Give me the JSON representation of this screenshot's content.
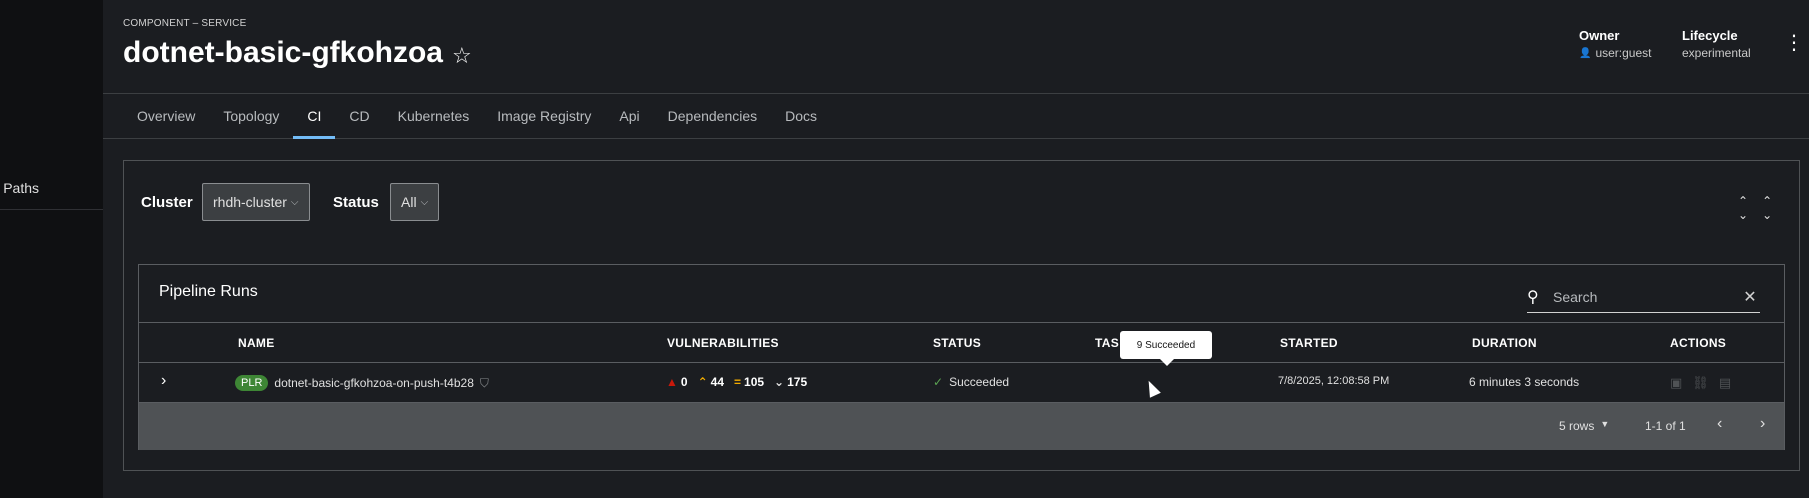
{
  "sidebar": {
    "item_label": "g Paths"
  },
  "header": {
    "kind": "COMPONENT – SERVICE",
    "title": "dotnet-basic-gfkohzoa",
    "owner_label": "Owner",
    "owner_value": "user:guest",
    "lifecycle_label": "Lifecycle",
    "lifecycle_value": "experimental"
  },
  "tabs": [
    {
      "label": "Overview"
    },
    {
      "label": "Topology"
    },
    {
      "label": "CI"
    },
    {
      "label": "CD"
    },
    {
      "label": "Kubernetes"
    },
    {
      "label": "Image Registry"
    },
    {
      "label": "Api"
    },
    {
      "label": "Dependencies"
    },
    {
      "label": "Docs"
    }
  ],
  "active_tab": "CI",
  "filters": {
    "cluster_label": "Cluster",
    "cluster_value": "rhdh-cluster",
    "status_label": "Status",
    "status_value": "All"
  },
  "runs": {
    "title": "Pipeline Runs",
    "search_placeholder": "Search",
    "columns": {
      "name": "NAME",
      "vulnerabilities": "VULNERABILITIES",
      "status": "STATUS",
      "task_status": "TAS",
      "started": "STARTED",
      "duration": "DURATION",
      "actions": "ACTIONS"
    },
    "rows": [
      {
        "badge": "PLR",
        "name": "dotnet-basic-gfkohzoa-on-push-t4b28",
        "critical": "0",
        "high": "44",
        "medium": "105",
        "low": "175",
        "status": "Succeeded",
        "started": "7/8/2025, 12:08:58 PM",
        "duration": "6 minutes 3 seconds"
      }
    ],
    "pagination": {
      "per_page": "5 rows",
      "range": "1-1 of 1"
    },
    "tooltip": "9 Succeeded"
  },
  "colors": {
    "accent": "#73bcf7",
    "success": "#3e8635",
    "critical": "#c9190b",
    "high": "#f0ab00"
  }
}
